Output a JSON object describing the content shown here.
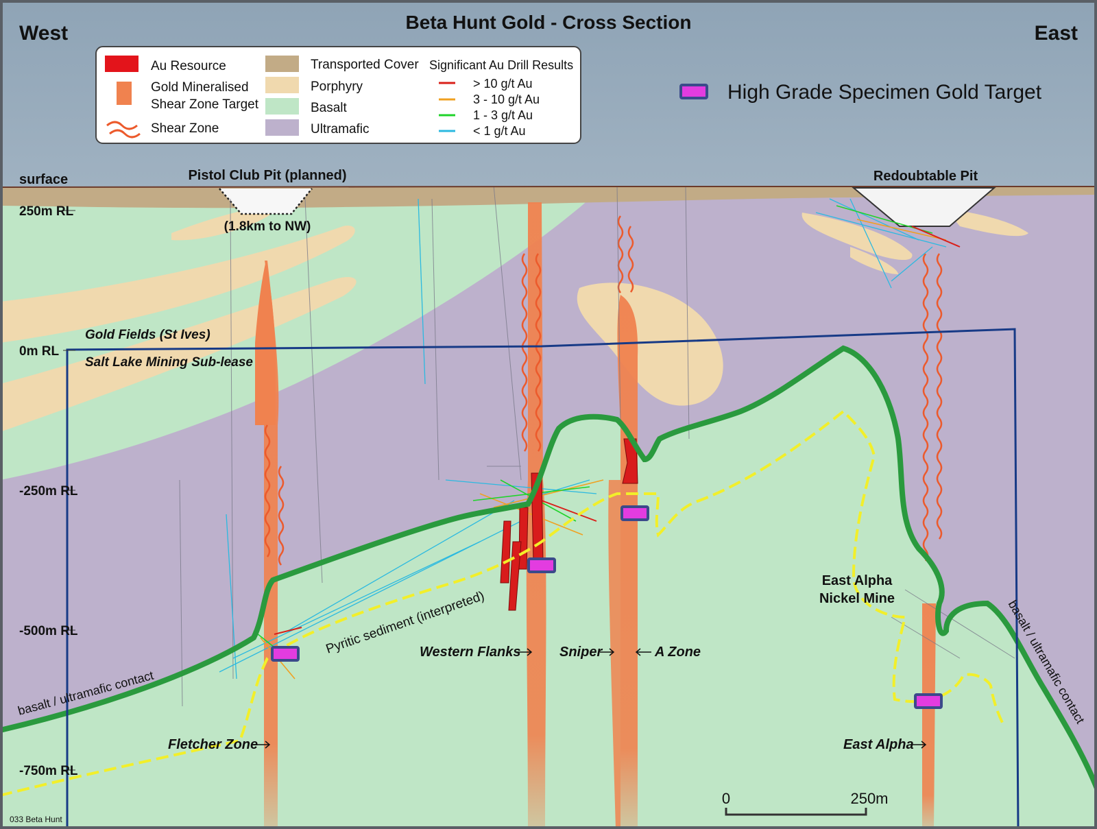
{
  "title": "Beta Hunt Gold - Cross Section",
  "compass": {
    "west": "West",
    "east": "East"
  },
  "legend": {
    "au_resource": "Au Resource",
    "gold_mineralised_1": "Gold Mineralised",
    "gold_mineralised_2": "Shear Zone Target",
    "shear_zone": "Shear Zone",
    "transported_cover": "Transported Cover",
    "porphyry": "Porphyry",
    "basalt": "Basalt",
    "ultramafic": "Ultramafic",
    "drill_title": "Significant Au Drill Results",
    "drill_gt10": "> 10 g/t Au",
    "drill_3_10": "3 - 10 g/t Au",
    "drill_1_3": "1 - 3 g/t Au",
    "drill_lt1": "< 1 g/t Au"
  },
  "target_label": "High Grade Specimen Gold Target",
  "rl_labels": {
    "surface": "surface",
    "rl250": "250m RL",
    "rl0": "0m RL",
    "rlm250": "-250m RL",
    "rlm500": "-500m RL",
    "rlm750": "-750m RL"
  },
  "annotations": {
    "pistol_club": "Pistol Club Pit (planned)",
    "pistol_dist": "(1.8km to NW)",
    "redoubtable": "Redoubtable Pit",
    "gold_fields": "Gold Fields (St Ives)",
    "salt_lake": "Salt Lake Mining Sub-lease",
    "pyritic": "Pyritic sediment (interpreted)",
    "contact_left": "basalt  /  ultramafic contact",
    "contact_right": "basalt / ultramafic contact",
    "east_alpha_mine_1": "East Alpha",
    "east_alpha_mine_2": "Nickel Mine",
    "western_flanks": "Western Flanks",
    "sniper": "Sniper",
    "a_zone": "A Zone",
    "fletcher": "Fletcher Zone",
    "east_alpha": "East Alpha",
    "figure_id": "033 Beta Hunt"
  },
  "scale_bar": {
    "start": "0",
    "end": "250m"
  },
  "colors": {
    "sky": "#a9b9c6",
    "cover": "#c2ab86",
    "porphyry": "#f0d9ae",
    "basalt": "#bfe6c6",
    "ultramafic": "#bdb1cc",
    "au_resource": "#e3141b",
    "gold_target": "#f0824f",
    "contact": "#2a9a3e",
    "pyritic": "#f2ef2a",
    "lease": "#173a86",
    "target_fill": "#e33ce0"
  }
}
